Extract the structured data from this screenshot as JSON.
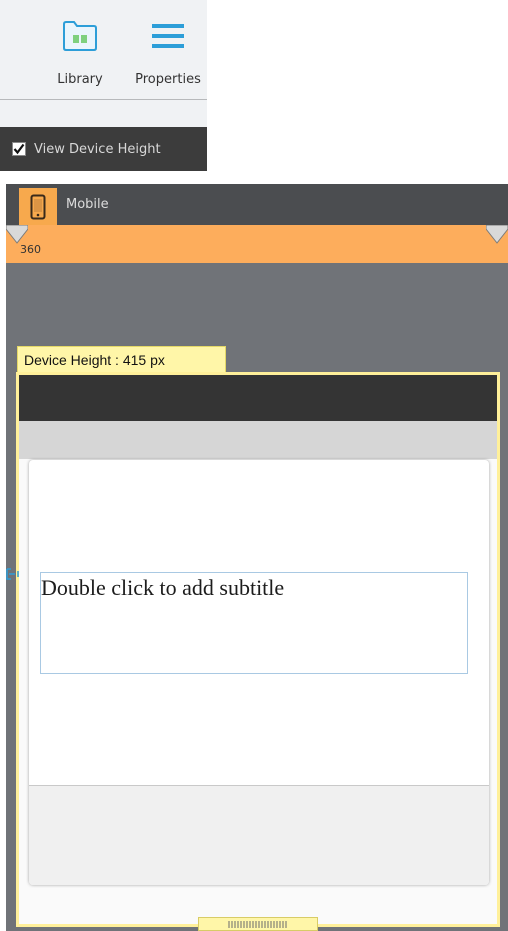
{
  "toolbar": {
    "library_label": "Library",
    "properties_label": "Properties"
  },
  "view_options": {
    "view_device_height_label": "View Device Height",
    "view_device_height_checked": true
  },
  "device": {
    "tab_label": "Mobile",
    "ruler_value": "360",
    "device_height_label": "Device Height : 415 px"
  },
  "content": {
    "subtitle_placeholder": "Double click to add subtitle"
  },
  "colors": {
    "accent_orange": "#fdad5c",
    "device_highlight": "#fff09a",
    "library_icon": "#2d9ed8",
    "library_book": "#7ed07e"
  },
  "icons": {
    "library": "library-icon",
    "properties": "properties-icon",
    "mobile": "mobile-device-icon"
  }
}
